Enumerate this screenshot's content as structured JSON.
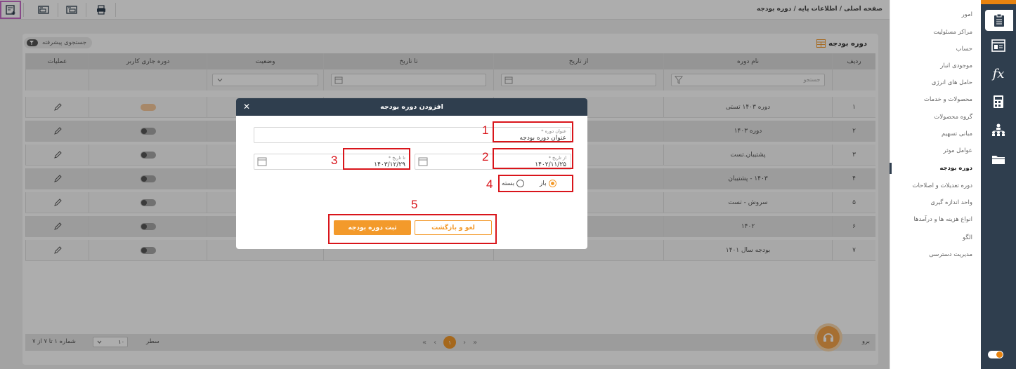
{
  "toolbar": {
    "buttons": [
      "add-icon",
      "report-icon",
      "report-alt-icon",
      "print-icon"
    ],
    "breadcrumb": "صفحه اصلی / اطلاعات پایه / دوره بودجه"
  },
  "sidebar": {
    "items": [
      {
        "label": "امور"
      },
      {
        "label": "مراکز مسئولیت"
      },
      {
        "label": "حساب"
      },
      {
        "label": "موجودی انبار"
      },
      {
        "label": "حامل های انرژی"
      },
      {
        "label": "محصولات و خدمات"
      },
      {
        "label": "گروه محصولات"
      },
      {
        "label": "مبانی تسهیم"
      },
      {
        "label": "عوامل موثر"
      },
      {
        "label": "دوره بودجه"
      },
      {
        "label": "دوره تعدیلات و اصلاحات"
      },
      {
        "label": "واحد اندازه گیری"
      },
      {
        "label": "انواع هزینه ها و درآمدها"
      },
      {
        "label": "الگو"
      },
      {
        "label": "مدیریت دسترسی"
      }
    ],
    "active_index": 9
  },
  "iconbar": {
    "icons": [
      "clipboard-icon",
      "list-icon",
      "fx-icon",
      "calculator-icon",
      "org-chart-icon",
      "folder-icon"
    ],
    "fx_label": "fx"
  },
  "panel": {
    "title": "دوره بودجه",
    "advanced_search": "جستجوی پیشرفته",
    "columns": [
      "ردیف",
      "نام دوره",
      "از تاریخ",
      "تا تاریخ",
      "وضعیت",
      "دوره جاری کاربر",
      "عملیات"
    ],
    "filter_placeholder": "جستجو",
    "rows": [
      {
        "index": "۱",
        "name": "دوره ۱۴۰۳ تستی",
        "current": true
      },
      {
        "index": "۲",
        "name": "دوره ۱۴۰۳",
        "current": false
      },
      {
        "index": "۳",
        "name": "پشتیبان.تست",
        "current": false
      },
      {
        "index": "۴",
        "name": "۱۴۰۳ - پشتیبان",
        "current": false
      },
      {
        "index": "۵",
        "name": "سروش - تست",
        "current": false
      },
      {
        "index": "۶",
        "name": "۱۴۰۲",
        "current": false
      },
      {
        "index": "۷",
        "name": "بودجه سال ۱۴۰۱",
        "current": false
      }
    ]
  },
  "pager": {
    "info": "شماره ۱ تا ۷ از ۷",
    "page_size": "۱۰",
    "rows_label": "سطر",
    "current_page": "۱",
    "right_label": "برو"
  },
  "modal": {
    "title": "افزودن دوره بودجه",
    "name_label": "عنوان دوره *",
    "name_value": "عنوان دوره بودجه",
    "from_label": "از تاریخ *",
    "from_value": "۱۴۰۲/۱۱/۲۵",
    "to_label": "تا تاریخ *",
    "to_value": "۱۴۰۳/۱۲/۲۹",
    "radio_open": "باز",
    "radio_closed": "بسته",
    "cancel_label": "لغو و بازگشت",
    "submit_label": "ثبت دوره بودجه",
    "annotations": [
      "1",
      "2",
      "3",
      "4",
      "5"
    ]
  },
  "colors": {
    "accent": "#f39a2b",
    "navy": "#2f3e4e",
    "annotation": "#d9151b"
  }
}
